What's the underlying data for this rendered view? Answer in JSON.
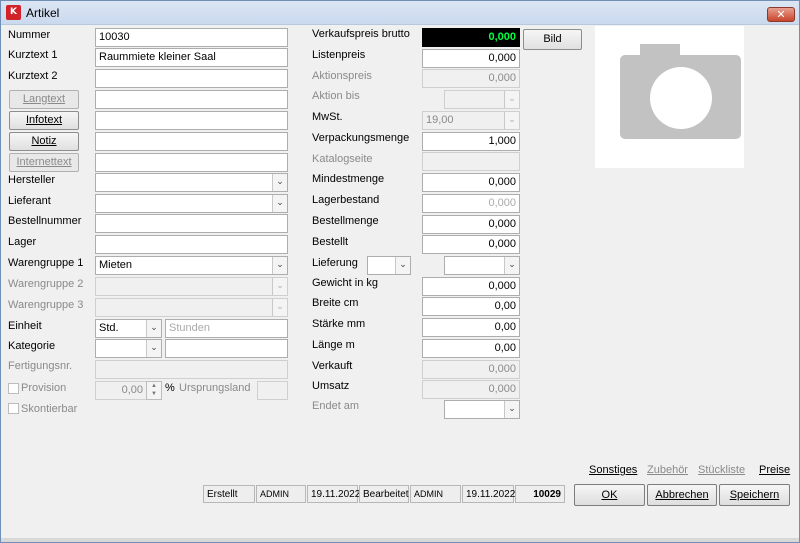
{
  "window": {
    "title": "Artikel",
    "icon": "K",
    "close": "✕"
  },
  "fields": {
    "nummer": {
      "label": "Nummer",
      "value": "10030"
    },
    "kurztext1": {
      "label": "Kurztext 1",
      "value": "Raummiete kleiner Saal"
    },
    "kurztext2": {
      "label": "Kurztext 2",
      "value": ""
    },
    "langtext": {
      "label": "Langtext",
      "value": ""
    },
    "infotext": {
      "label": "Infotext",
      "value": ""
    },
    "notiz": {
      "label": "Notiz",
      "value": ""
    },
    "internettext": {
      "label": "Internettext",
      "value": ""
    },
    "hersteller": {
      "label": "Hersteller",
      "value": ""
    },
    "lieferant": {
      "label": "Lieferant",
      "value": ""
    },
    "bestellnummer": {
      "label": "Bestellnummer",
      "value": ""
    },
    "lager": {
      "label": "Lager",
      "value": ""
    },
    "warengruppe1": {
      "label": "Warengruppe 1",
      "value": "Mieten"
    },
    "warengruppe2": {
      "label": "Warengruppe 2",
      "value": ""
    },
    "warengruppe3": {
      "label": "Warengruppe 3",
      "value": ""
    },
    "einheit": {
      "label": "Einheit",
      "value": "Std.",
      "text": "Stunden"
    },
    "kategorie": {
      "label": "Kategorie",
      "value": ""
    },
    "fertigungsnr": {
      "label": "Fertigungsnr.",
      "value": ""
    },
    "provision": {
      "label": "Provision",
      "value": "0,00",
      "unit": "%"
    },
    "ursprungsland": {
      "label": "Ursprungsland",
      "value": ""
    },
    "skontierbar": {
      "label": "Skontierbar"
    }
  },
  "prices": {
    "vk_brutto": {
      "label": "Verkaufspreis brutto",
      "value": "0,000"
    },
    "listenpreis": {
      "label": "Listenpreis",
      "value": "0,000"
    },
    "aktionspreis": {
      "label": "Aktionspreis",
      "value": "0,000"
    },
    "aktion_bis": {
      "label": "Aktion bis",
      "value": ""
    },
    "mwst": {
      "label": "MwSt.",
      "value": "19,00"
    },
    "verpackungsmenge": {
      "label": "Verpackungsmenge",
      "value": "1,000"
    },
    "katalogseite": {
      "label": "Katalogseite",
      "value": ""
    },
    "mindestmenge": {
      "label": "Mindestmenge",
      "value": "0,000"
    },
    "lagerbestand": {
      "label": "Lagerbestand",
      "value": "0,000"
    },
    "bestellmenge": {
      "label": "Bestellmenge",
      "value": "0,000"
    },
    "bestellt": {
      "label": "Bestellt",
      "value": "0,000"
    },
    "lieferung": {
      "label": "Lieferung",
      "value": "",
      "value2": ""
    },
    "gewicht": {
      "label": "Gewicht in kg",
      "value": "0,000"
    },
    "breite": {
      "label": "Breite cm",
      "value": "0,00"
    },
    "staerke": {
      "label": "Stärke mm",
      "value": "0,00"
    },
    "laenge": {
      "label": "Länge m",
      "value": "0,00"
    },
    "verkauft": {
      "label": "Verkauft",
      "value": "0,000"
    },
    "umsatz": {
      "label": "Umsatz",
      "value": "0,000"
    },
    "endet_am": {
      "label": "Endet am",
      "value": ""
    }
  },
  "bild_button": "Bild",
  "links": {
    "sonstiges": "Sonstiges",
    "zubehoer": "Zubehör",
    "stueckliste": "Stückliste",
    "preise": "Preise"
  },
  "status": {
    "erstellt_label": "Erstellt",
    "erstellt_user": "ADMIN",
    "erstellt_date": "19.11.2022",
    "bearbeitet_label": "Bearbeitet",
    "bearbeitet_user": "ADMIN",
    "bearbeitet_date": "19.11.2022",
    "id": "10029"
  },
  "buttons": {
    "ok": "OK",
    "abbrechen": "Abbrechen",
    "speichern": "Speichern"
  },
  "icons": {
    "dropdown": "chevron-down-icon",
    "photo": "camera-icon"
  },
  "colors": {
    "price_bg": "#000000",
    "price_fg": "#00ff40",
    "close": "#c8442c"
  }
}
